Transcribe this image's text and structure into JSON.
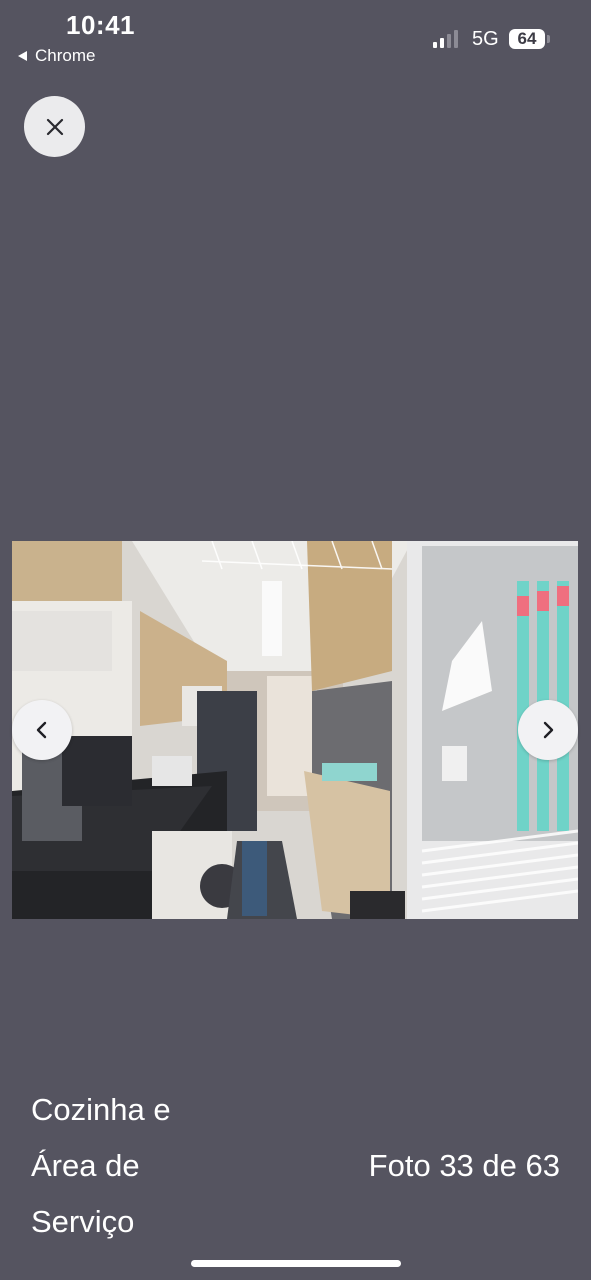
{
  "status_bar": {
    "time": "10:41",
    "back_app": "Chrome",
    "network": "5G",
    "battery": "64"
  },
  "photo": {
    "alt": "Cozinha e Área de Serviço"
  },
  "caption": {
    "title": "Cozinha e\nÁrea de\nServiço",
    "counter": "Foto 33 de 63"
  },
  "icons": {
    "close": "close-icon",
    "prev": "chevron-left-icon",
    "next": "chevron-right-icon"
  },
  "colors": {
    "background": "#555460",
    "button_bg": "#ebebed",
    "text": "#ffffff"
  }
}
